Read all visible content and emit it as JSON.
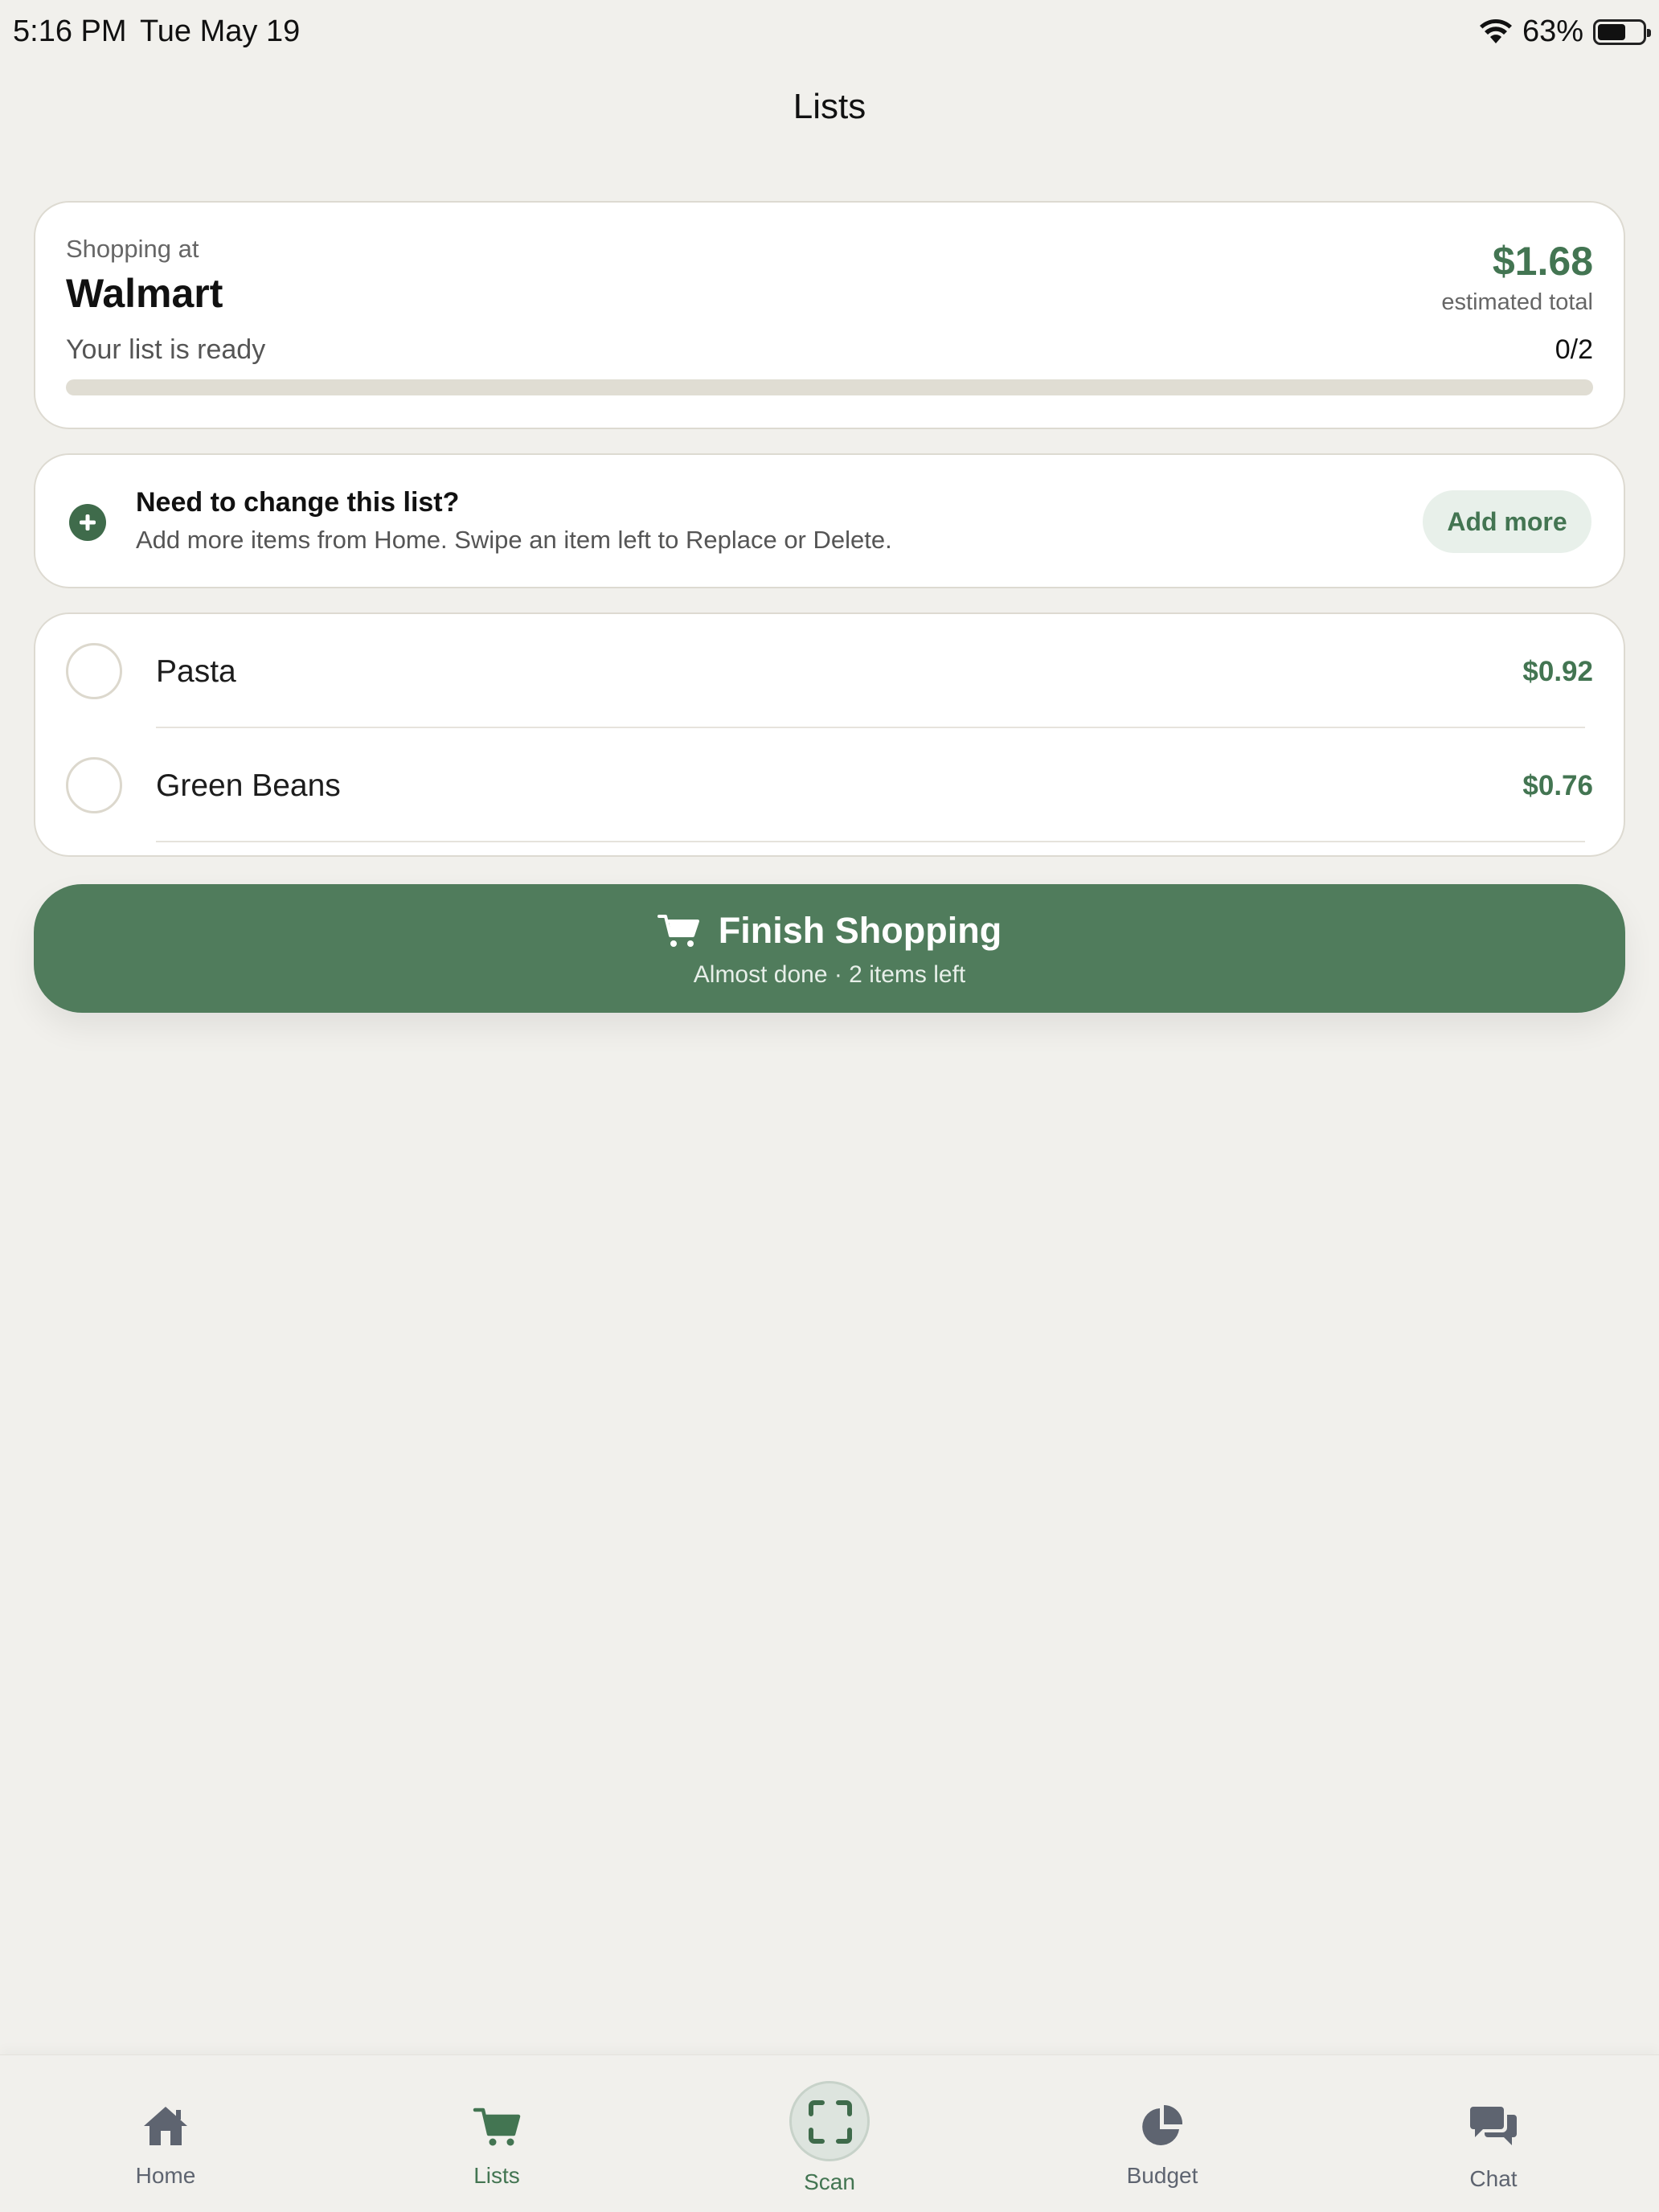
{
  "status_bar": {
    "time": "5:16 PM",
    "date": "Tue May 19",
    "battery": "63%",
    "battery_level": 0.63
  },
  "nav": {
    "title": "Lists"
  },
  "store": {
    "shopping_at_label": "Shopping at",
    "name": "Walmart",
    "total": "$1.68",
    "total_label": "estimated total",
    "status": "Your list is ready",
    "count": "0/2",
    "progress": 0
  },
  "change": {
    "title": "Need to change this list?",
    "description": "Add more items from Home. Swipe an item left to Replace or Delete.",
    "button": "Add more"
  },
  "items": [
    {
      "name": "Pasta",
      "price": "$0.92"
    },
    {
      "name": "Green Beans",
      "price": "$0.76"
    }
  ],
  "finish": {
    "title": "Finish Shopping",
    "subtitle": "Almost done · 2 items left"
  },
  "tabs": [
    {
      "label": "Home",
      "icon": "home-icon"
    },
    {
      "label": "Lists",
      "icon": "cart-icon",
      "active": true
    },
    {
      "label": "Scan",
      "icon": "scan-icon"
    },
    {
      "label": "Budget",
      "icon": "pie-chart-icon"
    },
    {
      "label": "Chat",
      "icon": "chat-bubbles-icon"
    }
  ],
  "colors": {
    "accent": "#437552",
    "button": "#507c5c",
    "background": "#f1f0ec",
    "tab_inactive": "#5e6470"
  }
}
